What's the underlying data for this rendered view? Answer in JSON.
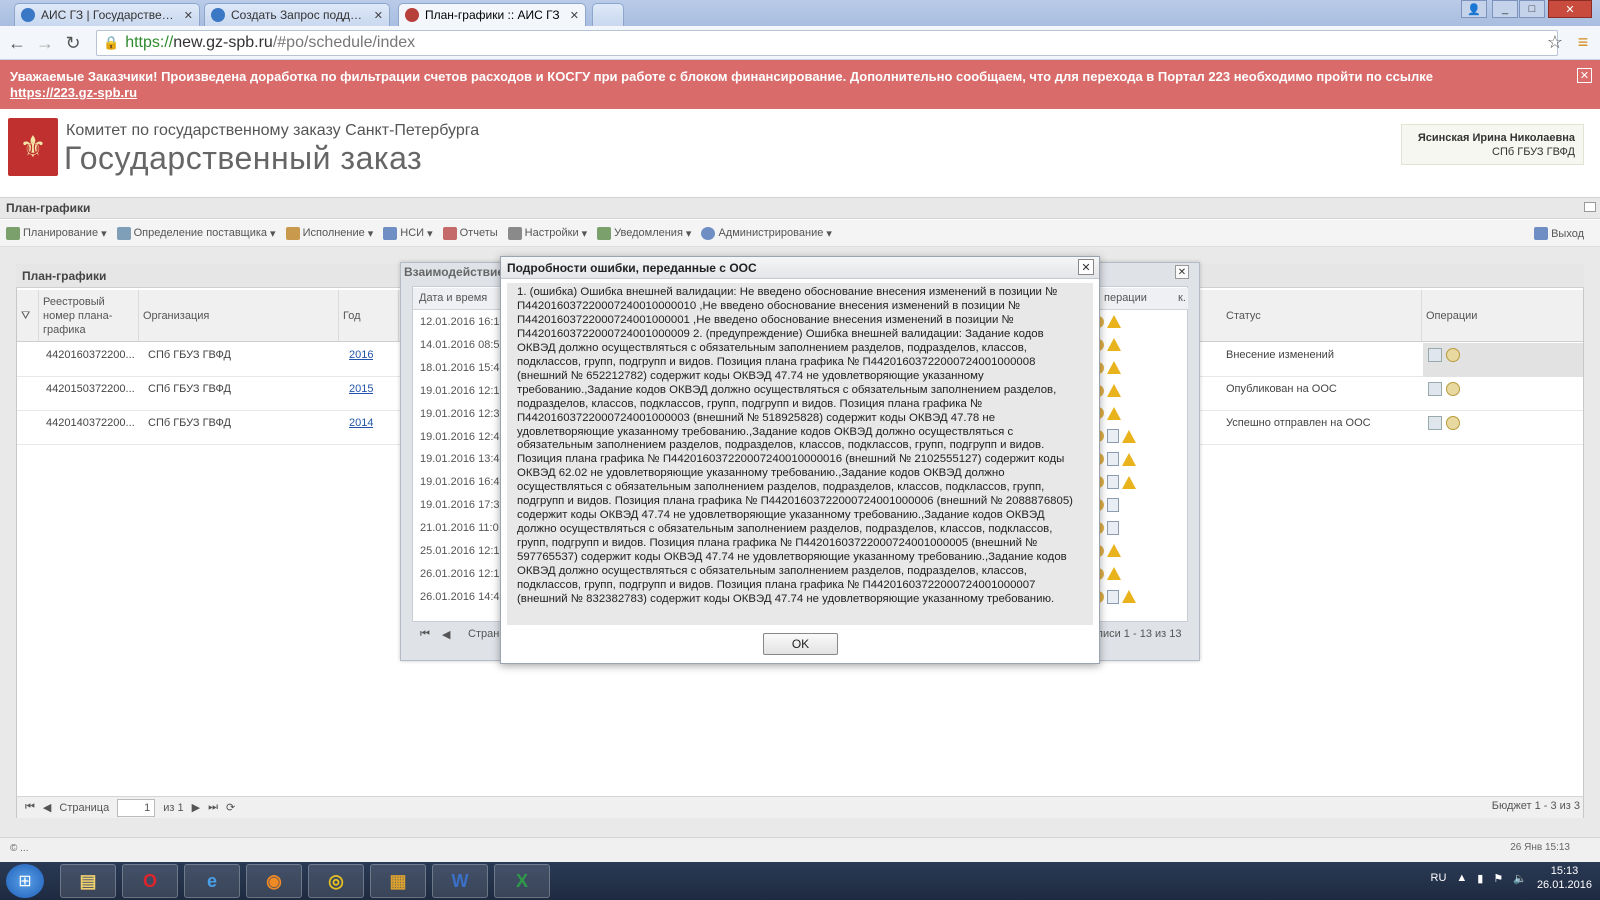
{
  "browser": {
    "tabs": [
      {
        "title": "АИС ГЗ | Государственны"
      },
      {
        "title": "Создать Запрос поддерж"
      },
      {
        "title": "План-графики :: АИС ГЗ"
      }
    ],
    "address_https": "https://",
    "address_domain": "new.gz-spb.ru",
    "address_path": "/#po/schedule/index"
  },
  "banner": {
    "text": "Уважаемые Заказчики! Произведена доработка по фильтрации счетов расходов и КОСГУ при работе с блоком финансирование. Дополнительно сообщаем, что для перехода в Портал 223 необходимо пройти по ссылке",
    "link": "https://223.gz-spb.ru"
  },
  "header": {
    "org_line1": "Комитет по государственному заказу Санкт-Петербурга",
    "org_line2": "Государственный заказ",
    "user_name": "Ясинская Ирина Николаевна",
    "user_org": "СПб ГБУЗ ГВФД"
  },
  "page": {
    "title": "План-графики",
    "menu": [
      "Планирование",
      "Определение поставщика",
      "Исполнение",
      "НСИ",
      "Отчеты",
      "Настройки",
      "Уведомления",
      "Администрирование"
    ],
    "logout": "Выход"
  },
  "grid": {
    "title": "План-графики",
    "columns": [
      "Реестровый номер плана-графика",
      "Организация",
      "Год",
      "Статус",
      "Операции"
    ],
    "rows": [
      {
        "number": "4420160372200...",
        "org": "СПб ГБУЗ ГВФД",
        "year": "2016",
        "status": "Внесение изменений"
      },
      {
        "number": "4420150372200...",
        "org": "СПб ГБУЗ ГВФД",
        "year": "2015",
        "status": "Опубликован на ООС"
      },
      {
        "number": "4420140372200...",
        "org": "СПб ГБУЗ ГВФД",
        "year": "2014",
        "status": "Успешно отправлен на ООС"
      }
    ],
    "pager_label": "Страница",
    "pager_value": "1",
    "pager_of": "из 1",
    "summary": "Бюджет 1 - 3 из 3"
  },
  "interaction_window": {
    "title": "Взаимодействие",
    "col_date": "Дата и время",
    "col_ops": "перации",
    "col_k": "к.",
    "dates": [
      "12.01.2016 16:1",
      "14.01.2016 08:5",
      "18.01.2016 15:4",
      "19.01.2016 12:1",
      "19.01.2016 12:3",
      "19.01.2016 12:4",
      "19.01.2016 13:4",
      "19.01.2016 16:4",
      "19.01.2016 17:3",
      "21.01.2016 11:0",
      "25.01.2016 12:1",
      "26.01.2016 12:1",
      "26.01.2016 14:4"
    ],
    "pager_label": "Стран",
    "summary": "писи 1 - 13 из 13"
  },
  "modal": {
    "title": "Подробности ошибки, переданные с ООС",
    "body": "1. (ошибка) Ошибка внешней валидации: Не введено обоснование внесения изменений в позиции № П442016037220007240010000010 ,Не введено обоснование внесения изменений в позиции № П44201603722000724001000001 ,Не введено обоснование внесения изменений в позиции № П44201603722000724001000009 2. (предупреждение) Ошибка внешней валидации: Задание кодов ОКВЭД должно осуществляться с обязательным заполнением разделов, подразделов, классов, подклассов, групп, подгрупп и видов. Позиция плана графика № П44201603722000724001000008 (внешний № 652212782) содержит коды ОКВЭД 47.74 не удовлетворяющие указанному требованию.,Задание кодов ОКВЭД должно осуществляться с обязательным заполнением разделов, подразделов, классов, подклассов, групп, подгрупп и видов. Позиция плана графика № П44201603722000724001000003 (внешний № 518925828) содержит коды ОКВЭД 47.78 не удовлетворяющие указанному требованию.,Задание кодов ОКВЭД должно осуществляться с обязательным заполнением разделов, подразделов, классов, подклассов, групп, подгрупп и видов. Позиция плана графика № П442016037220007240010000016 (внешний № 2102555127) содержит коды ОКВЭД 62.02 не удовлетворяющие указанному требованию.,Задание кодов ОКВЭД должно осуществляться с обязательным заполнением разделов, подразделов, классов, подклассов, групп, подгрупп и видов. Позиция плана графика № П44201603722000724001000006 (внешний № 2088876805) содержит коды ОКВЭД 47.74 не удовлетворяющие указанному требованию.,Задание кодов ОКВЭД должно осуществляться с обязательным заполнением разделов, подразделов, классов, подклассов, групп, подгрупп и видов. Позиция плана графика № П44201603722000724001000005 (внешний № 597765537) содержит коды ОКВЭД 47.74 не удовлетворяющие указанному требованию.,Задание кодов ОКВЭД должно осуществляться с обязательным заполнением разделов, подразделов, классов, подклассов, групп, подгрупп и видов. Позиция плана графика № П44201603722000724001000007 (внешний № 832382783) содержит коды ОКВЭД 47.74 не удовлетворяющие указанному требованию.",
    "ok": "OK"
  },
  "statusbar": {
    "left": "© ...",
    "right": "26 Янв 15:13"
  },
  "taskbar": {
    "lang": "RU",
    "time": "15:13",
    "date": "26.01.2016"
  }
}
